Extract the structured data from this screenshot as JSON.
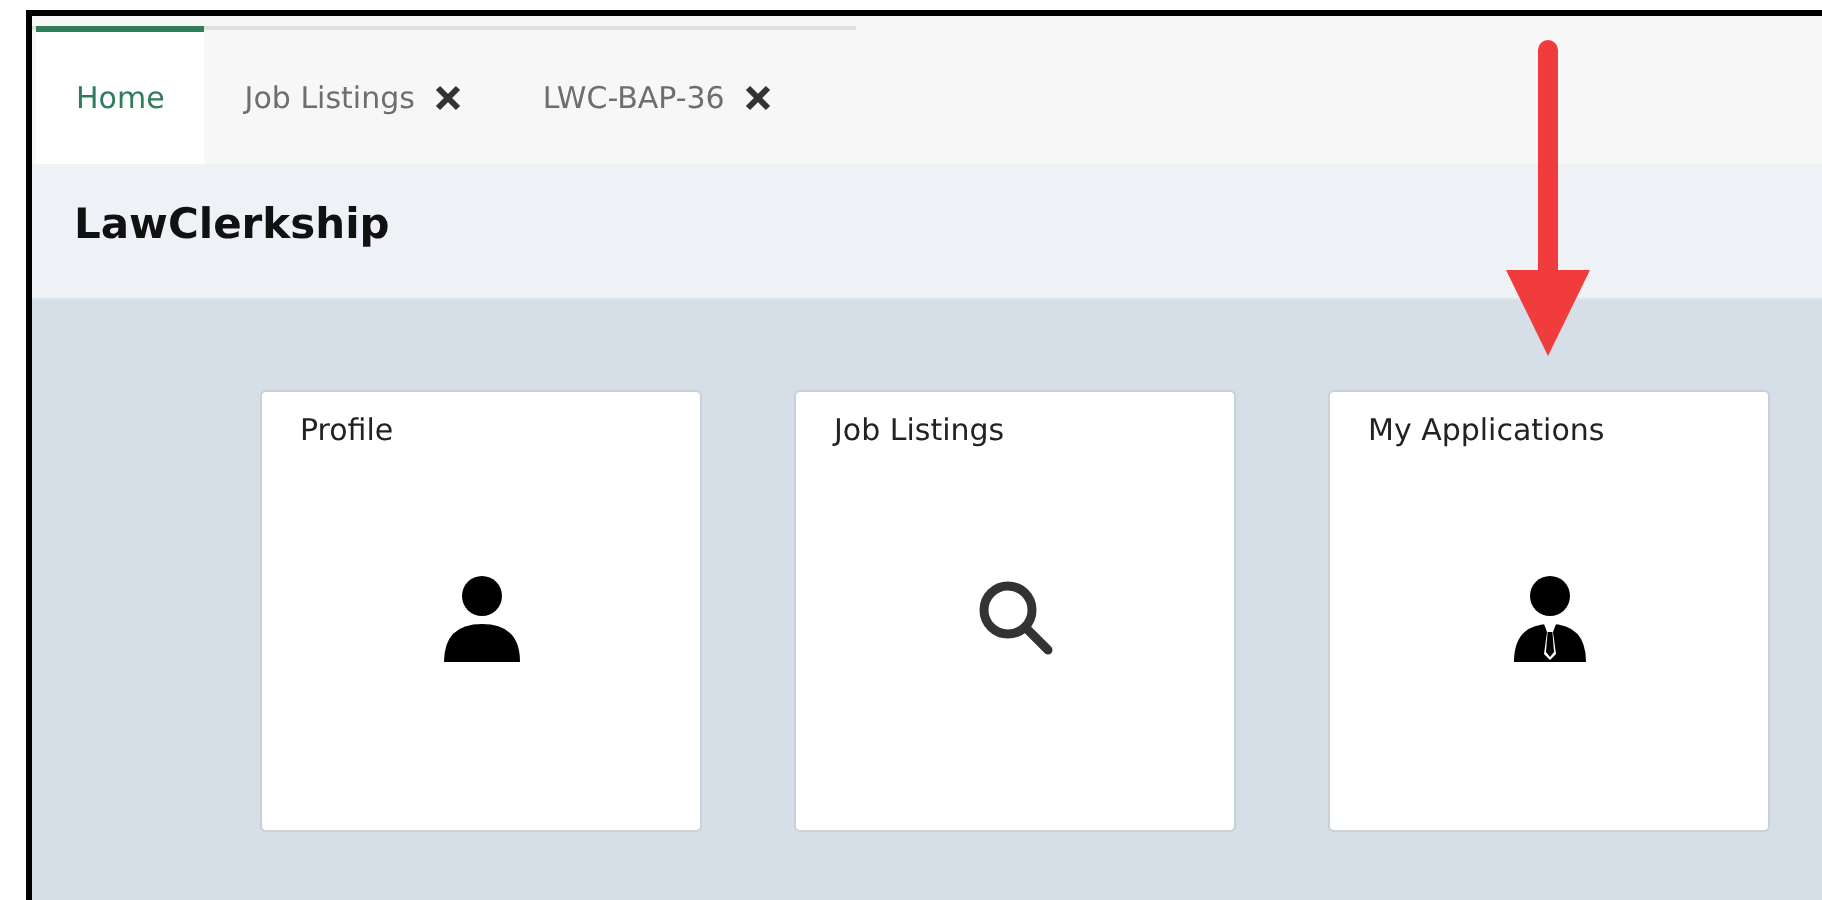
{
  "tabs": [
    {
      "label": "Home",
      "selected": true,
      "closable": false
    },
    {
      "label": "Job Listings",
      "selected": false,
      "closable": true
    },
    {
      "label": "LWC-BAP-36",
      "selected": false,
      "closable": true
    }
  ],
  "header": {
    "title": "LawClerkship"
  },
  "tiles": [
    {
      "title": "Profile",
      "kind": "person"
    },
    {
      "title": "Job Listings",
      "kind": "search"
    },
    {
      "title": "My Applications",
      "kind": "businessman"
    }
  ],
  "annotation": {
    "kind": "arrow"
  }
}
